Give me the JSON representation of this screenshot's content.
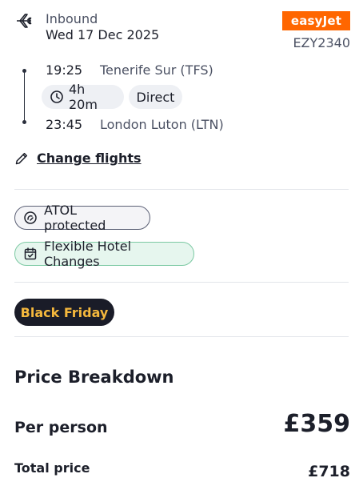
{
  "flight": {
    "direction": "Inbound",
    "date": "Wed 17 Dec 2025",
    "airline": "easyJet",
    "flight_number": "EZY2340",
    "departure": {
      "time": "19:25",
      "airport": "Tenerife Sur (TFS)"
    },
    "arrival": {
      "time": "23:45",
      "airport": "London Luton (LTN)"
    },
    "duration": "4h 20m",
    "stops": "Direct",
    "change_link": "Change flights"
  },
  "badges": {
    "atol": "ATOL protected",
    "flexible": "Flexible Hotel Changes",
    "promo": "Black Friday"
  },
  "price": {
    "title": "Price Breakdown",
    "per_person_label": "Per person",
    "per_person_value": "£359",
    "total_label": "Total price",
    "total_value": "£718"
  },
  "colors": {
    "airline_brand": "#ff6600",
    "promo_bg": "#1a1c28",
    "promo_text": "#f5b83d",
    "flex_border": "#7cc9a3"
  },
  "icons": [
    "plane-icon",
    "clock-icon",
    "pencil-icon",
    "atol-icon",
    "calendar-check-icon"
  ]
}
